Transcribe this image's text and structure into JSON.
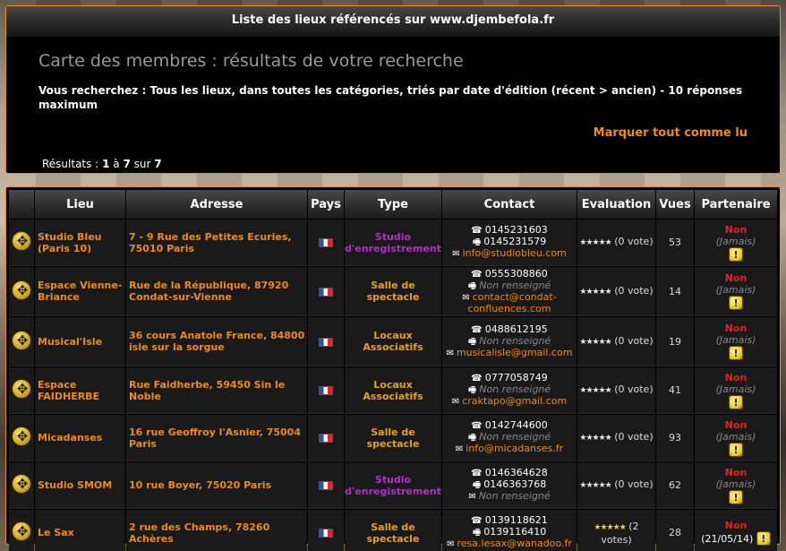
{
  "header": {
    "title": "Liste des lieux référencés sur www.djembefola.fr"
  },
  "page_title": "Carte des membres : résultats de votre recherche",
  "query_text": "Vous recherchez : Tous les lieux, dans toutes les catégories, triés par date d'édition (récent > ancien) - 10 réponses maximum",
  "mark_all_read": "Marquer tout comme lu",
  "results": {
    "label": "Résultats :",
    "from": "1",
    "to_word": "à",
    "to": "7",
    "of_word": "sur",
    "total": "7"
  },
  "columns": [
    "Lieu",
    "Adresse",
    "Pays",
    "Type",
    "Contact",
    "Evaluation",
    "Vues",
    "Partenaire"
  ],
  "rows": [
    {
      "lieu": "Studio Bleu (Paris 10)",
      "adresse": "7 - 9 Rue des Petites Ecuries, 75010 Paris",
      "type": "Studio d'enregistrement",
      "type_class": "t-studio",
      "tel1": "0145231603",
      "tel2": "0145231579",
      "email": "info@studiobleu.com",
      "eval_stars": "★★★★★",
      "eval_text": "(0 vote)",
      "vues": "53",
      "partenaire": "Non",
      "part_date": "(Jamais)"
    },
    {
      "lieu": "Espace Vienne-Briance",
      "adresse": "Rue de la République, 87920 Condat-sur-Vienne",
      "type": "Salle de spectacle",
      "type_class": "t-salle",
      "tel1": "0555308860",
      "tel2": "Non renseigné",
      "email": "contact@condat-confluences.com",
      "eval_stars": "★★★★★",
      "eval_text": "(0 vote)",
      "vues": "14",
      "partenaire": "Non",
      "part_date": "(Jamais)"
    },
    {
      "lieu": "Musical'Isle",
      "adresse": "36 cours Anatole France, 84800 isle sur la sorgue",
      "type": "Locaux Associatifs",
      "type_class": "t-locaux",
      "tel1": "0488612195",
      "tel2": "Non renseigné",
      "email": "musicalisle@gmail.com",
      "eval_stars": "★★★★★",
      "eval_text": "(0 vote)",
      "vues": "19",
      "partenaire": "Non",
      "part_date": "(Jamais)"
    },
    {
      "lieu": "Espace FAIDHERBE",
      "adresse": "Rue Faidherbe, 59450 Sin le Noble",
      "type": "Locaux Associatifs",
      "type_class": "t-locaux",
      "tel1": "0777058749",
      "tel2": "Non renseigné",
      "email": "craktapo@gmail.com",
      "eval_stars": "★★★★★",
      "eval_text": "(0 vote)",
      "vues": "41",
      "partenaire": "Non",
      "part_date": "(Jamais)"
    },
    {
      "lieu": "Micadanses",
      "adresse": "16 rue Geoffroy l'Asnier, 75004 Paris",
      "type": "Salle de spectacle",
      "type_class": "t-salle",
      "tel1": "0142744600",
      "tel2": "Non renseigné",
      "email": "info@micadanses.fr",
      "eval_stars": "★★★★★",
      "eval_text": "(0 vote)",
      "vues": "93",
      "partenaire": "Non",
      "part_date": "(Jamais)"
    },
    {
      "lieu": "Studio SMOM",
      "adresse": "10 rue Boyer, 75020 Paris",
      "type": "Studio d'enregistrement",
      "type_class": "t-studio",
      "tel1": "0146364628",
      "tel2": "0146363768",
      "email": "Non renseigné",
      "eval_stars": "★★★★★",
      "eval_text": "(0 vote)",
      "vues": "62",
      "partenaire": "Non",
      "part_date": "(Jamais)"
    },
    {
      "lieu": "Le Sax",
      "adresse": "2 rue des Champs, 78260 Achères",
      "type": "Salle de spectacle",
      "type_class": "t-salle",
      "tel1": "0139118621",
      "tel2": "0139116410",
      "email": "resa.lesax@wanadoo.fr",
      "eval_stars": "★★★★★",
      "eval_text": "(2 votes)",
      "vues": "28",
      "partenaire": "Non",
      "part_date": "(21/05/14)",
      "gold": true
    }
  ],
  "icons": {
    "phone": "☎",
    "fax": "🖷",
    "email": "✉",
    "place": "diamond-place-icon",
    "warn": "!"
  },
  "colors": {
    "accent": "#f08a1e",
    "studio": "#b030c8",
    "salle": "#e8a020",
    "non": "#e82020"
  }
}
